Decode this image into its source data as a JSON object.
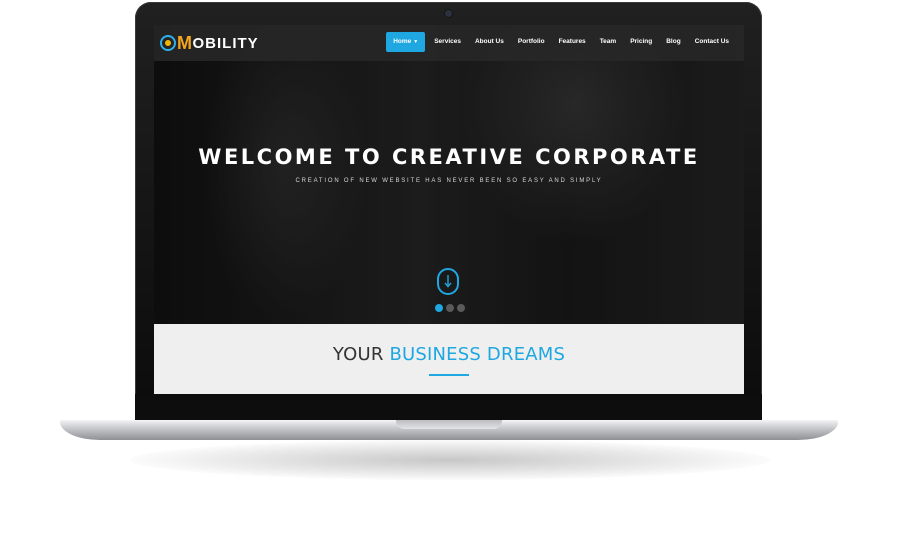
{
  "brand": {
    "first_letter": "M",
    "rest": "OBILITY",
    "accent_color": "#1ea7e1",
    "logo_letter_color": "#f2a51f"
  },
  "nav": {
    "items": [
      {
        "label": "Home",
        "active": true,
        "has_dropdown": true
      },
      {
        "label": "Services"
      },
      {
        "label": "About Us"
      },
      {
        "label": "Portfolio"
      },
      {
        "label": "Features"
      },
      {
        "label": "Team"
      },
      {
        "label": "Pricing"
      },
      {
        "label": "Blog"
      },
      {
        "label": "Contact Us"
      }
    ]
  },
  "hero": {
    "title": "WELCOME TO CREATIVE CORPORATE",
    "subtitle": "CREATION OF NEW WEBSITE HAS NEVER BEEN SO EASY AND SIMPLY",
    "scroll_icon": "mouse-scroll-icon",
    "slides_total": 3,
    "slide_active": 1
  },
  "section": {
    "heading_plain": "YOUR",
    "heading_accent": "BUSINESS DREAMS"
  }
}
